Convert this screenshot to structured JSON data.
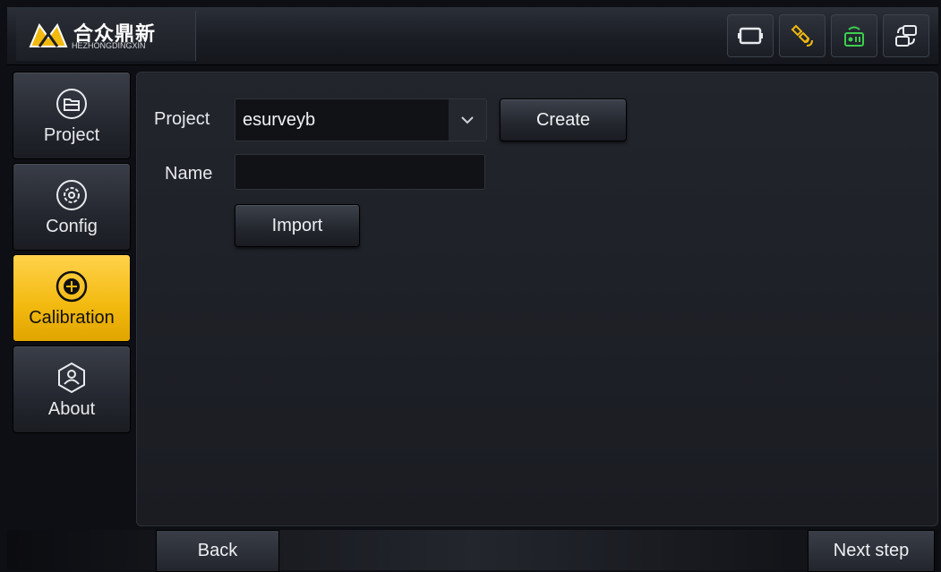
{
  "header": {
    "logo_cn": "合众鼎新",
    "logo_en": "HEZHONGDINGXIN",
    "icons": [
      "screen-icon",
      "satellite-icon",
      "radio-icon",
      "switch-icon"
    ],
    "accent": "#f2b90f",
    "radio_color": "#3ccf4e"
  },
  "sidebar": {
    "items": [
      {
        "label": "Project",
        "icon": "folder-icon",
        "active": false
      },
      {
        "label": "Config",
        "icon": "gear-icon",
        "active": false
      },
      {
        "label": "Calibration",
        "icon": "calibration-icon",
        "active": true
      },
      {
        "label": "About",
        "icon": "about-icon",
        "active": false
      }
    ]
  },
  "form": {
    "project_label": "Project",
    "project_value": "esurveyb",
    "create_label": "Create",
    "name_label": "Name",
    "name_value": "",
    "import_label": "Import"
  },
  "footer": {
    "back_label": "Back",
    "next_label": "Next step"
  }
}
